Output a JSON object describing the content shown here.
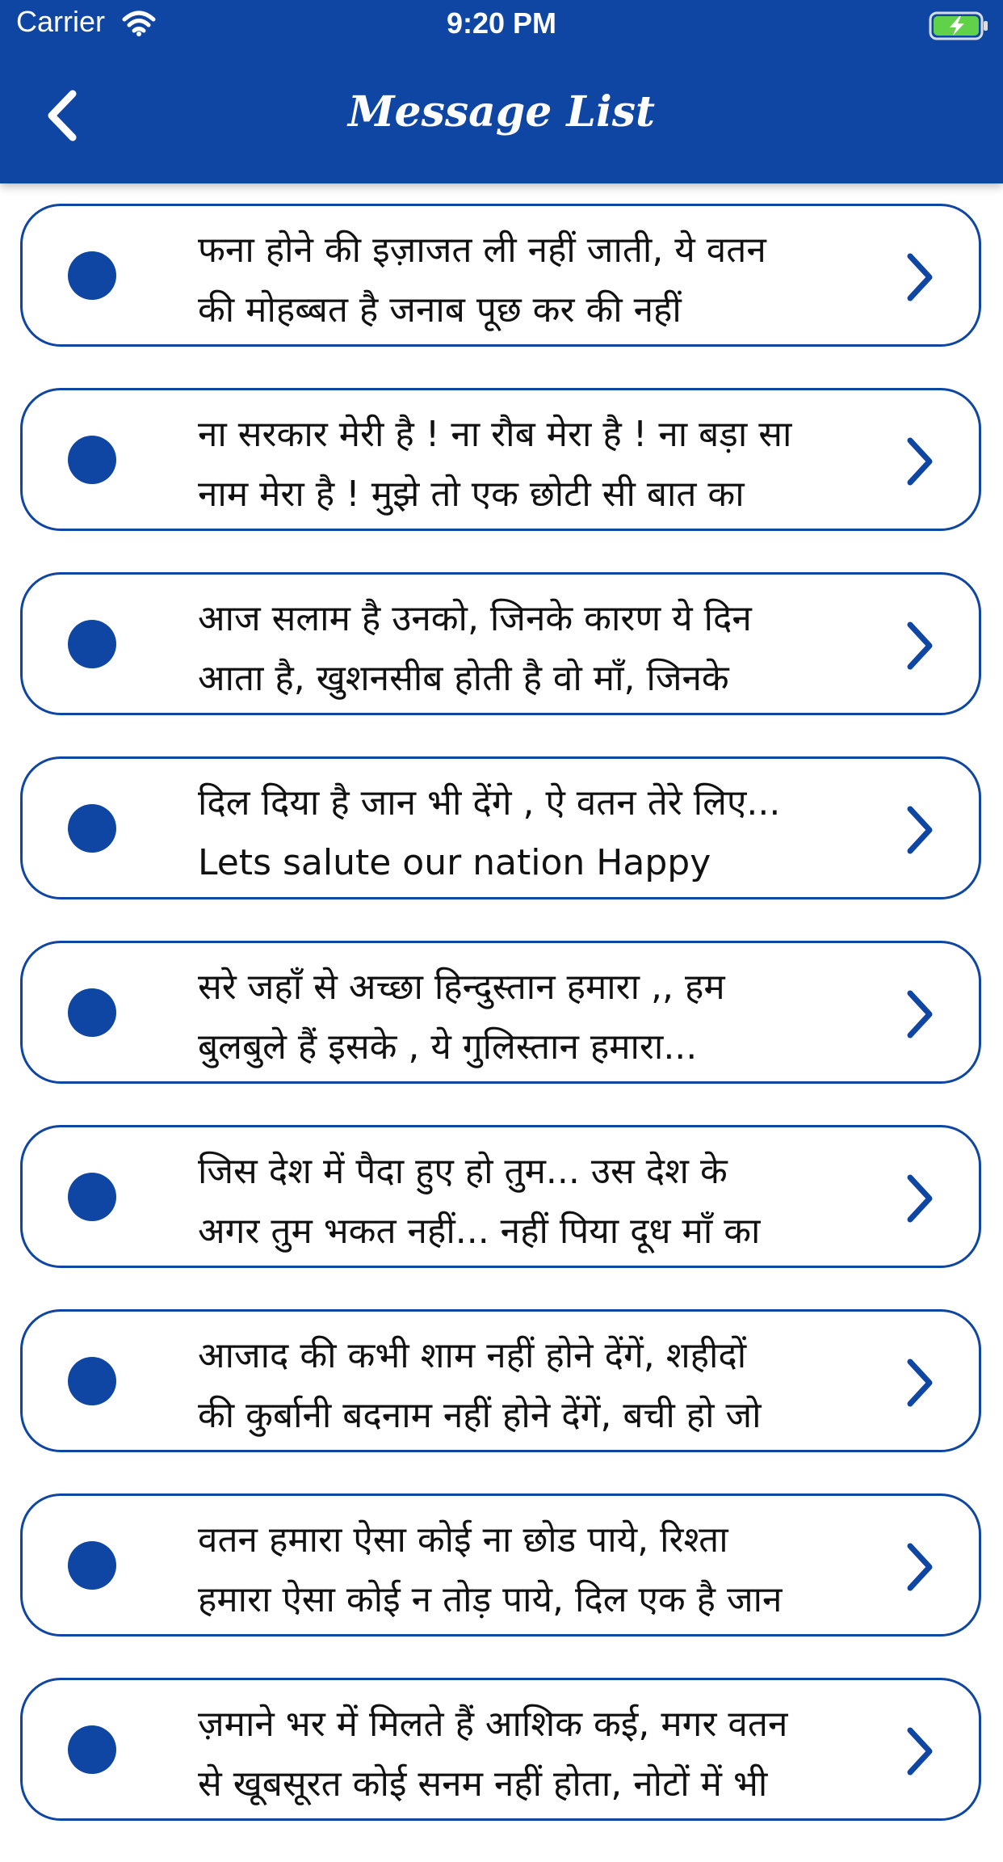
{
  "status_bar": {
    "carrier": "Carrier",
    "time": "9:20 PM"
  },
  "header": {
    "title": "Message List",
    "background_color": "#0f45a3"
  },
  "messages": [
    {
      "line1": "फना होने की इज़ाजत ली नहीं जाती, ये वतन",
      "line2": "की मोहब्बत है जनाब पूछ कर की नहीं"
    },
    {
      "line1": "ना सरकार मेरी है ! ना रौब मेरा है ! ना बड़ा सा",
      "line2": "नाम मेरा है ! मुझे तो एक छोटी सी बात का"
    },
    {
      "line1": "आज सलाम है उनको, जिनके कारण ये दिन",
      "line2": "आता है, खुशनसीब होती है वो माँ, जिनके"
    },
    {
      "line1": "दिल दिया है जान भी देंगे , ऐ वतन तेरे लिए...",
      "line2": "Lets salute our nation Happy"
    },
    {
      "line1": "सरे जहाँ से अच्छा हिन्दुस्तान हमारा ,, हम",
      "line2": "बुलबुले हैं इसके , ये गुलिस्तान हमारा..."
    },
    {
      "line1": "जिस देश में पैदा हुए हो तुम... उस देश के",
      "line2": "अगर तुम भकत नहीं... नहीं पिया दूध माँ का"
    },
    {
      "line1": "आजाद की कभी शाम नहीं होने देंगें, शहीदों",
      "line2": "की कुर्बानी बदनाम नहीं होने देंगें, बची हो जो"
    },
    {
      "line1": "वतन हमारा ऐसा कोई ना छोड पाये, रिश्ता",
      "line2": "हमारा ऐसा कोई न तोड़ पाये, दिल एक है जान"
    },
    {
      "line1": "ज़माने भर में मिलते हैं आशिक कई, मगर वतन",
      "line2": "से खूबसूरत कोई सनम नहीं होता, नोटों में भी"
    }
  ],
  "icons": {
    "back": "chevron-left-icon",
    "item_arrow": "chevron-right-icon",
    "item_bullet": "bullet-dot-icon",
    "wifi": "wifi-icon",
    "battery": "battery-charging-icon"
  }
}
